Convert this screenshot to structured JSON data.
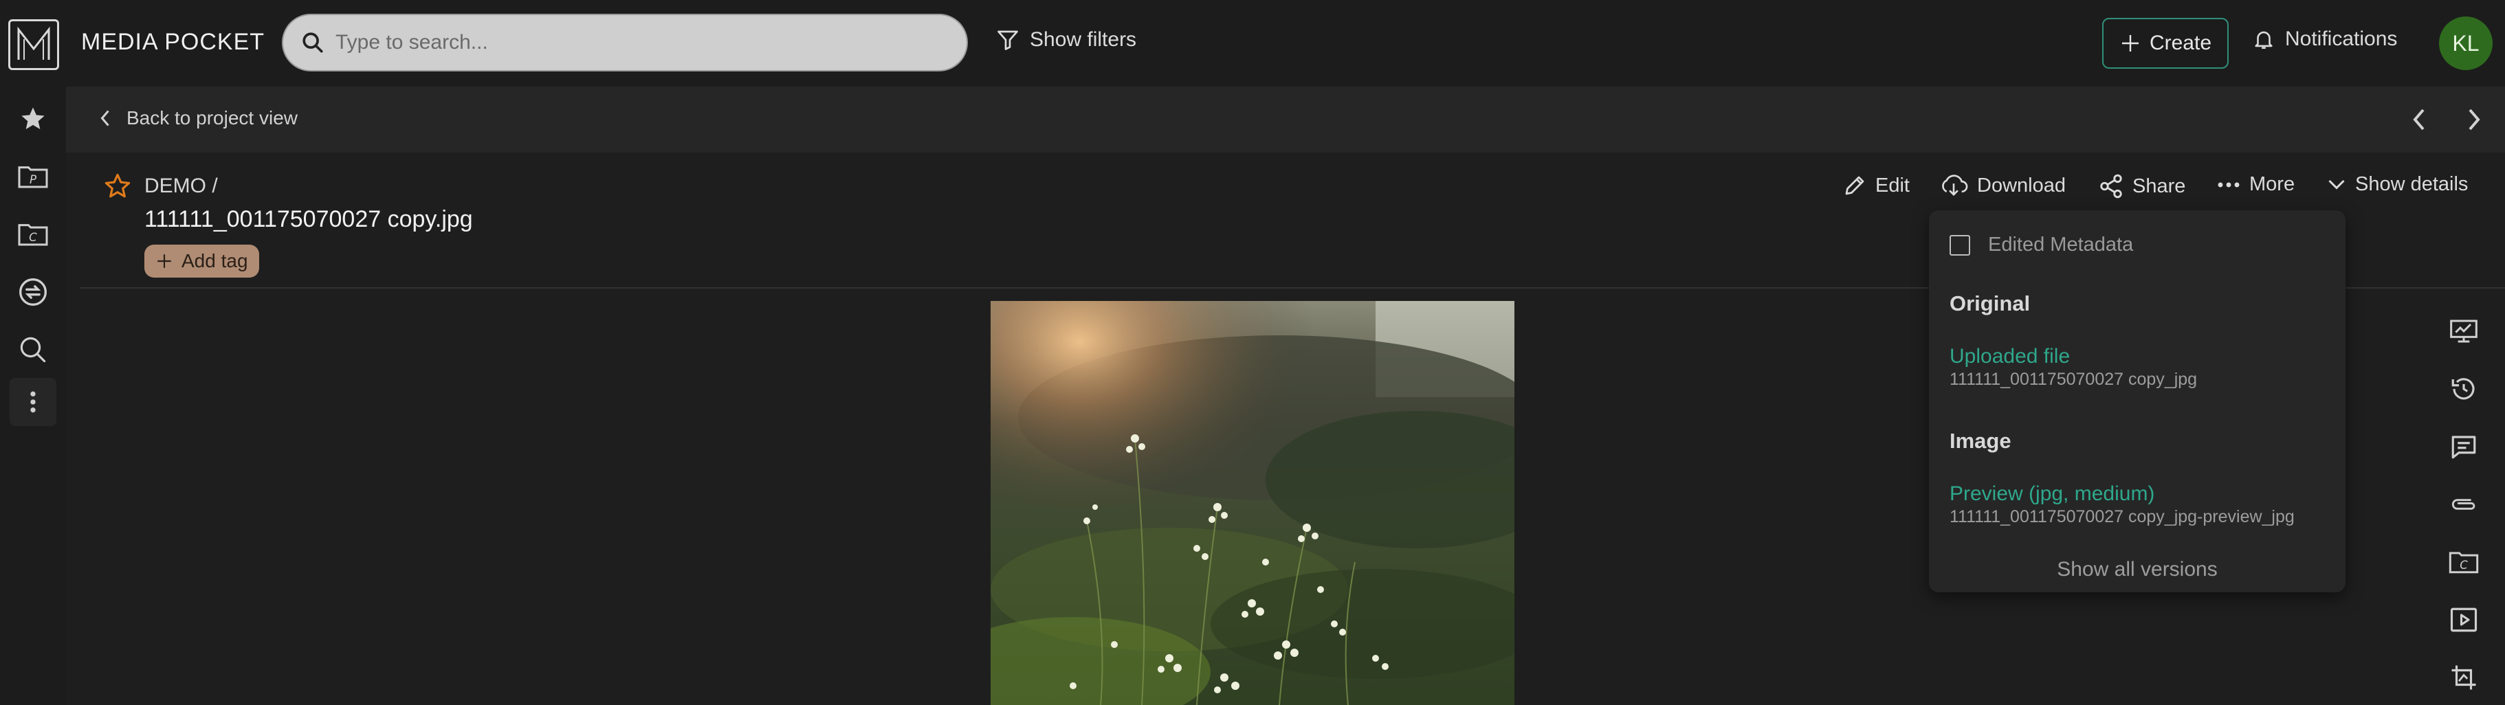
{
  "app": {
    "brand": "MEDIA POCKET",
    "search_placeholder": "Type to search...",
    "show_filters": "Show filters",
    "create": "Create",
    "notifications": "Notifications",
    "avatar_initials": "KL",
    "accent": "#2f8f7a",
    "link_color": "#2fa88c"
  },
  "left_rail": {
    "items": [
      "star-icon",
      "project-folder-icon",
      "collection-folder-icon",
      "sync-icon",
      "search-icon",
      "more-vertical-icon"
    ]
  },
  "subbar": {
    "back": "Back to project view"
  },
  "asset": {
    "breadcrumb": "DEMO /",
    "title": "111111_001175070027 copy.jpg",
    "add_tag": "Add tag"
  },
  "actions": {
    "edit": "Edit",
    "download": "Download",
    "share": "Share",
    "more": "More",
    "show_details": "Show details"
  },
  "versions_dropdown": {
    "edited_metadata": "Edited Metadata",
    "original_heading": "Original",
    "original_link": "Uploaded file",
    "original_file": "111111_001175070027 copy_jpg",
    "image_heading": "Image",
    "image_link": "Preview (jpg, medium)",
    "image_file": "111111_001175070027 copy_jpg-preview_jpg",
    "show_all": "Show all versions"
  },
  "right_rail": {
    "items": [
      "presentation-icon",
      "history-icon",
      "comments-icon",
      "attachment-icon",
      "collection-folder-icon",
      "play-icon",
      "crop-icon"
    ]
  }
}
